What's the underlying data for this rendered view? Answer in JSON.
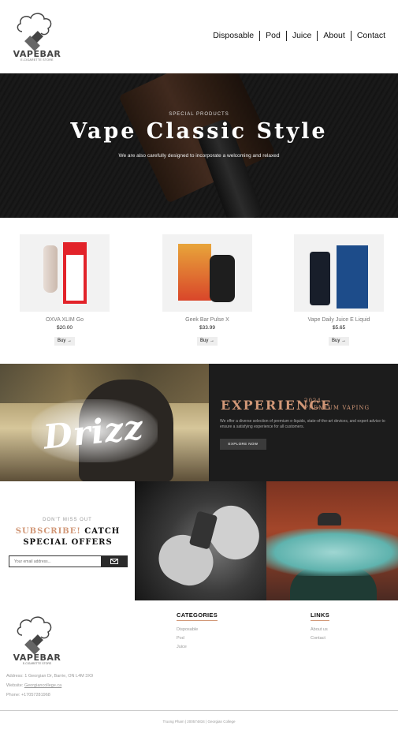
{
  "brand": {
    "name": "VAPEBAR",
    "tagline": "E-CIGARETTE STORE"
  },
  "nav": {
    "items": [
      "Disposable",
      "Pod",
      "Juice",
      "About",
      "Contact"
    ]
  },
  "hero": {
    "eyebrow": "SPECIAL PRODUCTS",
    "title": "Vape Classic Style",
    "subtitle": "We are also carefully designed to incorporate a welcoming and relaxed"
  },
  "products": [
    {
      "name": "OXVA XLIM Go",
      "price": "$20.00",
      "buy_label": "Buy →"
    },
    {
      "name": "Geek Bar Pulse X",
      "price": "$33.99",
      "buy_label": "Buy →"
    },
    {
      "name": "Vape Daily Juice E Liquid",
      "price": "$5.65",
      "buy_label": "Buy →"
    }
  ],
  "banner": {
    "brand_word": "Drizz",
    "experience": "EXPERIENCE",
    "year": "2024",
    "tag": "PREMIUM VAPING",
    "description": "We offer a diverse selection of premium e-liquids, state-of-the-art devices, and expert advice to ensure a satisfying experience for all customers.",
    "cta": "EXPLORE NOW"
  },
  "subscribe": {
    "eyebrow": "DON'T MISS OUT",
    "title_accent": "SUBSCRIBE!",
    "title_rest": "CATCH SPECIAL OFFERS",
    "placeholder": "Your email address..."
  },
  "footer": {
    "address": "Address: 1 Georgian Dr, Barrie, ON L4M 3X9",
    "website_label": "Website:",
    "website": "Georgiancollege.ca",
    "phone": "Phone: +17057281968",
    "categories_title": "CATEGORIES",
    "categories": [
      "Disposable",
      "Pod",
      "Juice"
    ],
    "links_title": "LINKS",
    "links": [
      "About us",
      "Contact"
    ],
    "copyright": "Truong Pham | 200574834 | Georgian College"
  },
  "colors": {
    "accent": "#d19777",
    "dark": "#1c1c1c"
  },
  "icons": {
    "logo": "cloud-vape-icon",
    "send": "envelope-icon",
    "arrow": "arrow-right-icon"
  }
}
